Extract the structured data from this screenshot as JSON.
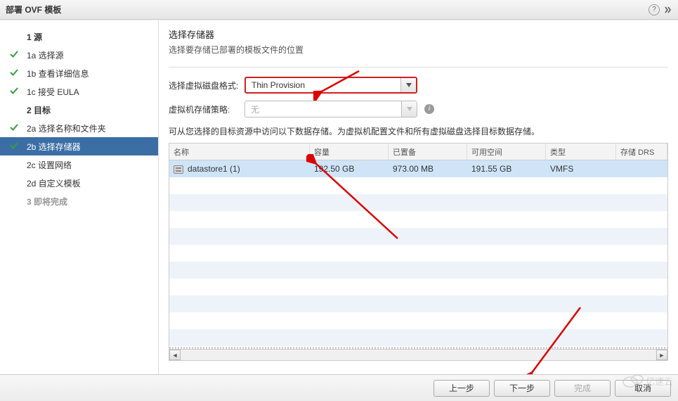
{
  "window": {
    "title": "部署 OVF 模板"
  },
  "sidebar": {
    "steps": [
      {
        "label": "1 源",
        "level": 1,
        "checked": false
      },
      {
        "label": "1a 选择源",
        "level": 2,
        "checked": true
      },
      {
        "label": "1b 查看详细信息",
        "level": 2,
        "checked": true
      },
      {
        "label": "1c 接受 EULA",
        "level": 2,
        "checked": true
      },
      {
        "label": "2 目标",
        "level": 1,
        "checked": false
      },
      {
        "label": "2a 选择名称和文件夹",
        "level": 2,
        "checked": true
      },
      {
        "label": "2b 选择存储器",
        "level": 2,
        "checked": true,
        "current": true
      },
      {
        "label": "2c 设置网络",
        "level": 2,
        "checked": false
      },
      {
        "label": "2d 自定义模板",
        "level": 2,
        "checked": false
      },
      {
        "label": "3 即将完成",
        "level": 1,
        "checked": false,
        "disabled": true
      }
    ]
  },
  "content": {
    "title": "选择存储器",
    "subtitle": "选择要存储已部署的模板文件的位置",
    "disk_format_label": "选择虚拟磁盘格式:",
    "disk_format_value": "Thin Provision",
    "storage_policy_label": "虚拟机存储策略:",
    "storage_policy_value": "无",
    "instruction": "可从您选择的目标资源中访问以下数据存储。为虚拟机配置文件和所有虚拟磁盘选择目标数据存储。",
    "table": {
      "headers": {
        "name": "名称",
        "capacity": "容量",
        "provisioned": "已置备",
        "free": "可用空间",
        "type": "类型",
        "drs": "存储 DRS"
      },
      "rows": [
        {
          "name": "datastore1 (1)",
          "capacity": "192.50 GB",
          "provisioned": "973.00 MB",
          "free": "191.55 GB",
          "type": "VMFS",
          "drs": ""
        }
      ]
    }
  },
  "footer": {
    "back": "上一步",
    "next": "下一步",
    "finish": "完成",
    "cancel": "取消"
  },
  "watermark": "亿速云"
}
